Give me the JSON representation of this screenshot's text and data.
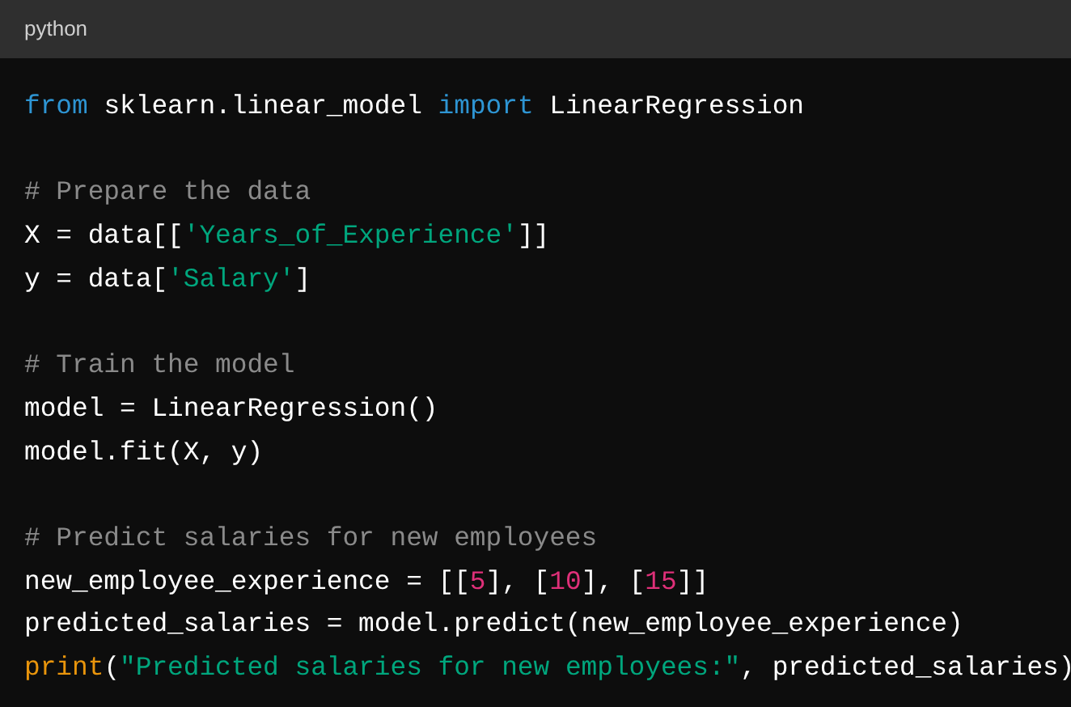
{
  "header": {
    "language": "python"
  },
  "blocks": [
    {
      "lines": [
        [
          {
            "kind": "keyword",
            "text": "from"
          },
          {
            "kind": "plain",
            "text": " sklearn.linear_model "
          },
          {
            "kind": "keyword",
            "text": "import"
          },
          {
            "kind": "plain",
            "text": " LinearRegression"
          }
        ]
      ]
    },
    {
      "lines": [
        [
          {
            "kind": "comment",
            "text": "# Prepare the data"
          }
        ],
        [
          {
            "kind": "plain",
            "text": "X = data[["
          },
          {
            "kind": "string",
            "text": "'Years_of_Experience'"
          },
          {
            "kind": "plain",
            "text": "]]"
          }
        ],
        [
          {
            "kind": "plain",
            "text": "y = data["
          },
          {
            "kind": "string",
            "text": "'Salary'"
          },
          {
            "kind": "plain",
            "text": "]"
          }
        ]
      ]
    },
    {
      "lines": [
        [
          {
            "kind": "comment",
            "text": "# Train the model"
          }
        ],
        [
          {
            "kind": "plain",
            "text": "model = LinearRegression()"
          }
        ],
        [
          {
            "kind": "plain",
            "text": "model.fit(X, y)"
          }
        ]
      ]
    },
    {
      "lines": [
        [
          {
            "kind": "comment",
            "text": "# Predict salaries for new employees"
          }
        ],
        [
          {
            "kind": "plain",
            "text": "new_employee_experience = [["
          },
          {
            "kind": "number",
            "text": "5"
          },
          {
            "kind": "plain",
            "text": "], ["
          },
          {
            "kind": "number",
            "text": "10"
          },
          {
            "kind": "plain",
            "text": "], ["
          },
          {
            "kind": "number",
            "text": "15"
          },
          {
            "kind": "plain",
            "text": "]]"
          }
        ],
        [
          {
            "kind": "plain",
            "text": "predicted_salaries = model.predict(new_employee_experience)"
          }
        ],
        [
          {
            "kind": "builtin",
            "text": "print"
          },
          {
            "kind": "plain",
            "text": "("
          },
          {
            "kind": "string",
            "text": "\"Predicted salaries for new employees:\""
          },
          {
            "kind": "plain",
            "text": ", predicted_salaries)"
          }
        ]
      ]
    }
  ]
}
